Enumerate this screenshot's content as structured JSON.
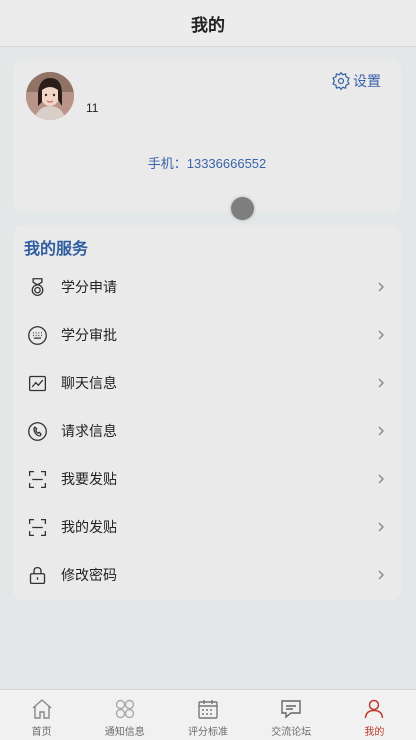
{
  "header": {
    "title": "我的"
  },
  "profile": {
    "username": "11",
    "settings_label": "设置",
    "phone_text": "手机：13336666552"
  },
  "services": {
    "title": "我的服务",
    "items": [
      {
        "label": "学分申请",
        "icon": "medal-icon"
      },
      {
        "label": "学分审批",
        "icon": "keyboard-icon"
      },
      {
        "label": "聊天信息",
        "icon": "chart-icon"
      },
      {
        "label": "请求信息",
        "icon": "phone-icon"
      },
      {
        "label": "我要发贴",
        "icon": "scan-icon"
      },
      {
        "label": "我的发贴",
        "icon": "scan-icon"
      },
      {
        "label": "修改密码",
        "icon": "lock-icon"
      }
    ]
  },
  "tabbar": {
    "tabs": [
      {
        "label": "首页",
        "icon": "home-icon"
      },
      {
        "label": "通知信息",
        "icon": "grid-icon"
      },
      {
        "label": "评分标准",
        "icon": "calendar-icon"
      },
      {
        "label": "交流论坛",
        "icon": "chat-icon"
      },
      {
        "label": "我的",
        "icon": "user-icon",
        "active": true
      }
    ]
  },
  "colors": {
    "accent": "#2f5d9e",
    "active_tab": "#c0392b",
    "background": "#e3e7e8"
  }
}
